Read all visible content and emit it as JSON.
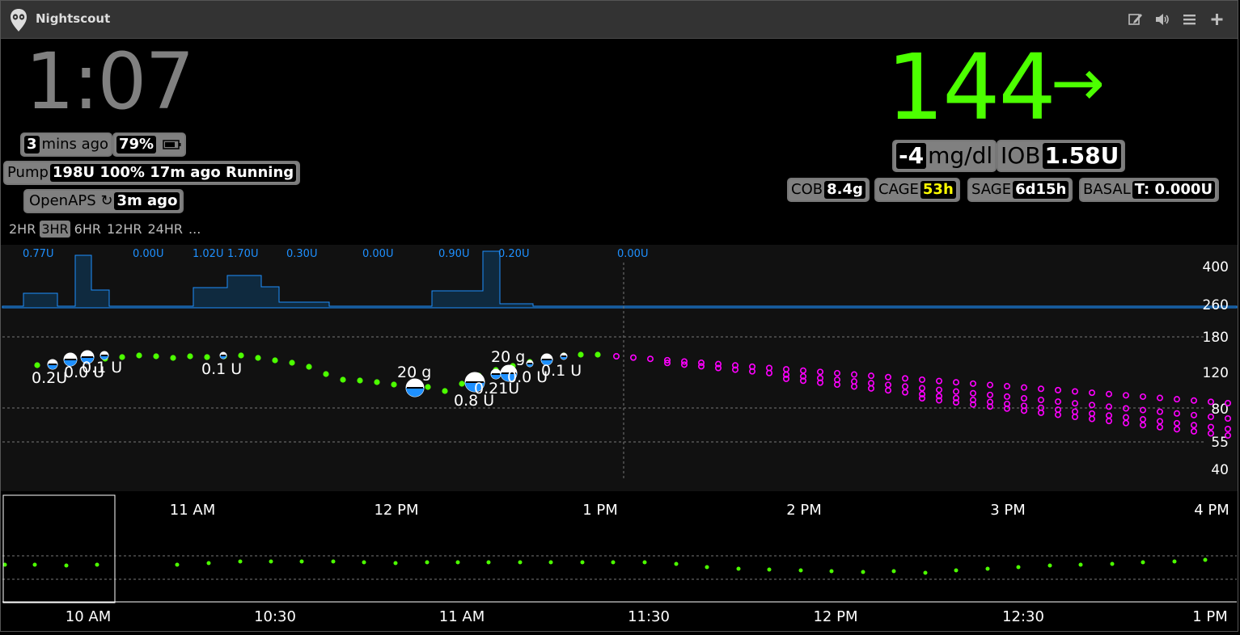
{
  "app": {
    "title": "Nightscout"
  },
  "header": {
    "icons": [
      "edit-icon",
      "volume-icon",
      "menu-icon",
      "plus-icon"
    ]
  },
  "clock": {
    "time": "1:07"
  },
  "status": {
    "last_reading_count": "3",
    "last_reading_unit": "mins ago",
    "battery": "79%",
    "pump_label": "Pump",
    "pump_value": "198U 100% 17m ago Running",
    "openaps_label": "OpenAPS ↻",
    "openaps_value": "3m ago"
  },
  "bg": {
    "value": "144",
    "arrow": "→",
    "delta": "-4",
    "units": "mg/dl",
    "iob_label": "IOB",
    "iob_value": "1.58U",
    "color": "#4cff00"
  },
  "pills": {
    "cob_label": "COB",
    "cob_value": "8.4g",
    "cage_label": "CAGE",
    "cage_value": "53h",
    "sage_label": "SAGE",
    "sage_value": "6d15h",
    "basal_label": "BASAL",
    "basal_value": "T: 0.000U"
  },
  "ranges": {
    "items": [
      "2HR",
      "3HR",
      "6HR",
      "12HR",
      "24HR",
      "..."
    ],
    "active": "3HR"
  },
  "chart": {
    "basal_labels": [
      "0.77U",
      "0.00U",
      "1.02U",
      "1.70U",
      "0.30U",
      "0.00U",
      "0.90U",
      "0.20U",
      "0.00U"
    ],
    "y_ticks": [
      "400",
      "260",
      "180",
      "120",
      "80",
      "55",
      "40"
    ],
    "x_ticks": [
      "11 AM",
      "12 PM",
      "1 PM",
      "2 PM",
      "3 PM",
      "4 PM"
    ],
    "bolus_labels": [
      "0.2U",
      "0.0 U",
      "0.1 U",
      "0.1 U",
      "0.8 U",
      "0.21U",
      "0.0 U",
      "0.1 U"
    ],
    "carb_labels": [
      "20 g",
      "20 g"
    ]
  },
  "brush": {
    "x_ticks": [
      "10 AM",
      "10:30",
      "11 AM",
      "11:30",
      "12 PM",
      "12:30",
      "1 PM"
    ]
  },
  "colors": {
    "accent_green": "#4cff00",
    "prediction": "#ff00ff",
    "basal": "#1e90ff",
    "cage_highlight": "#ffff00"
  }
}
